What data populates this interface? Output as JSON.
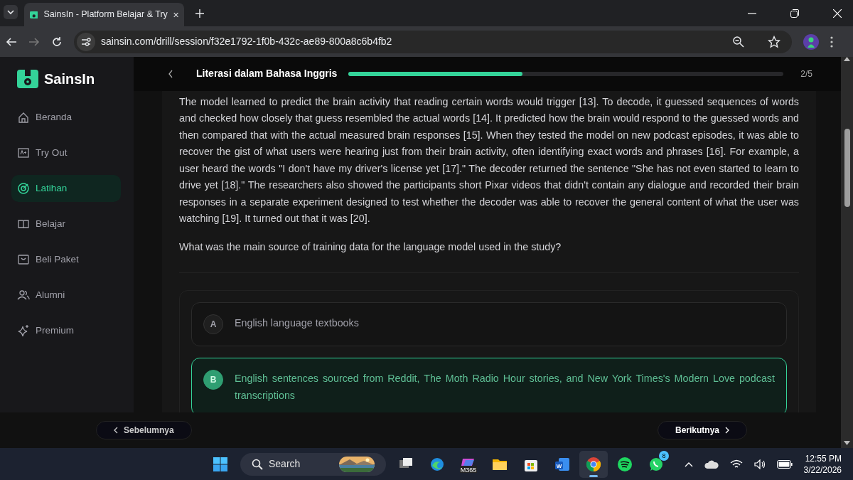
{
  "browser": {
    "tab_title": "SainsIn - Platform Belajar & Try",
    "url": "sainsin.com/drill/session/f32e1792-1f0b-432c-ae89-800a8c6b4fb2"
  },
  "sidebar": {
    "logo": "SainsIn",
    "items": [
      {
        "label": "Beranda",
        "kind": "home",
        "selected": false
      },
      {
        "label": "Try Out",
        "kind": "tryout",
        "selected": false
      },
      {
        "label": "Latihan",
        "kind": "target",
        "selected": true
      },
      {
        "label": "Belajar",
        "kind": "book",
        "selected": false
      },
      {
        "label": "Beli Paket",
        "kind": "bag",
        "selected": false
      },
      {
        "label": "Alumni",
        "kind": "users",
        "selected": false
      },
      {
        "label": "Premium",
        "kind": "sparkle",
        "selected": false
      }
    ]
  },
  "header": {
    "title": "Literasi dalam Bahasa Inggris",
    "level": 0.4,
    "count": "2/5"
  },
  "passage": "The model learned to predict the brain activity that reading certain words would trigger [13]. To decode, it guessed sequences of words and checked how closely that guess resembled the actual words [14]. It predicted how the brain would respond to the guessed words and then compared that with the actual measured brain responses [15]. When they tested the model on new podcast episodes, it was able to recover the gist of what users were hearing just from their brain activity, often identifying exact words and phrases [16]. For example, a user heard the words \"I don't have my driver's license yet [17].\" The decoder returned the sentence \"She has not even started to learn to drive yet [18].\" The researchers also showed the participants short Pixar videos that didn't contain any dialogue and recorded their brain responses in a separate experiment designed to test whether the decoder was able to recover the general content of what the user was watching [19]. It turned out that it was [20].",
  "question": "What was the main source of training data for the language model used in the study?",
  "options": [
    {
      "letter": "A",
      "text": "English language textbooks",
      "selected": false
    },
    {
      "letter": "B",
      "text": "English sentences sourced from Reddit, The Moth Radio Hour stories, and New York Times's Modern Love podcast transcriptions",
      "selected": true
    }
  ],
  "footer": {
    "previous": "Sebelumnya",
    "next": "Berikutnya"
  },
  "taskbar": {
    "search": "Search",
    "apps": [
      {
        "kind": "taskview",
        "selected": false
      },
      {
        "kind": "edge",
        "selected": false
      },
      {
        "kind": "m365",
        "label": "M365",
        "selected": false
      },
      {
        "kind": "explorer",
        "selected": false
      },
      {
        "kind": "store",
        "selected": false
      },
      {
        "kind": "word",
        "label": "W",
        "selected": false
      },
      {
        "kind": "chrome",
        "selected": true
      },
      {
        "kind": "spotify",
        "selected": false
      },
      {
        "kind": "whatsapp",
        "badge": "8",
        "selected": false
      }
    ],
    "time": "12:55 PM",
    "date": "3/22/2026"
  }
}
